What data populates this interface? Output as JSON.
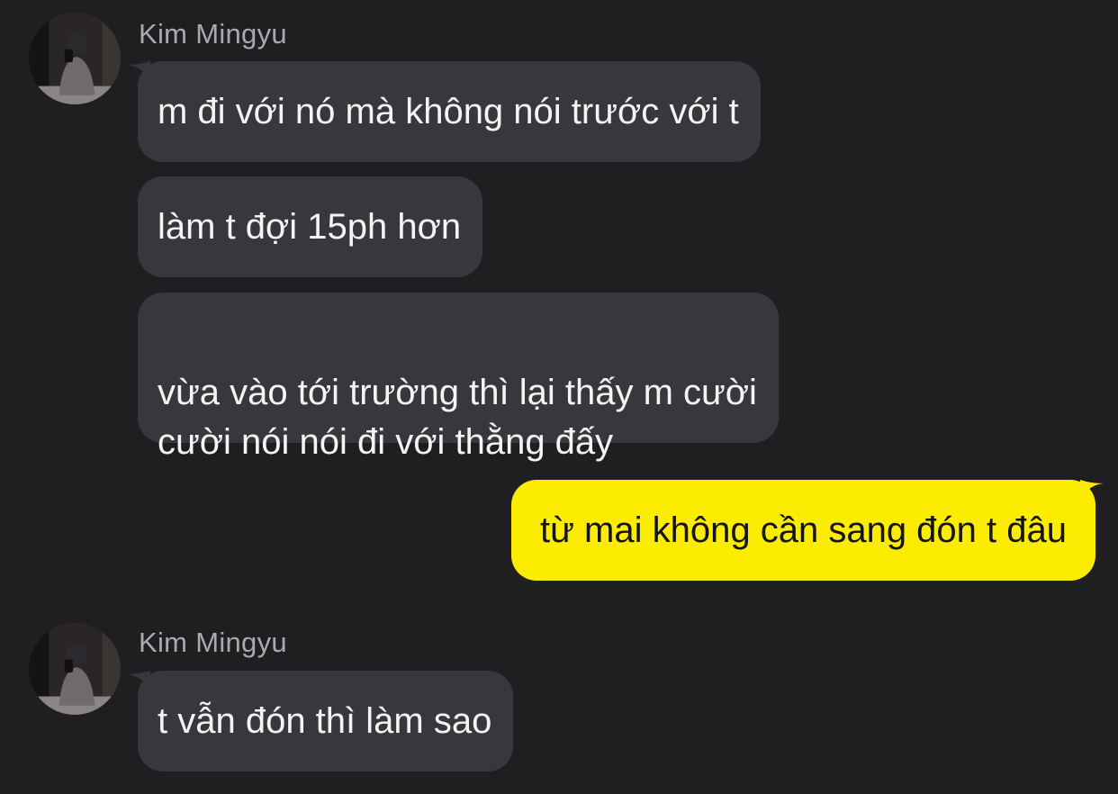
{
  "conversation": {
    "groups": [
      {
        "sender": "Kim Mingyu",
        "messages": [
          "m đi với nó mà không nói trước với t",
          "làm t đợi 15ph hơn",
          "vừa vào tới trường thì lại thấy m cười\ncười nói nói đi với thằng đấy"
        ]
      },
      {
        "sender": "me",
        "messages": [
          "từ mai không cần sang đón t đâu"
        ]
      },
      {
        "sender": "Kim Mingyu",
        "messages": [
          "t vẫn đón thì làm sao"
        ]
      }
    ]
  },
  "colors": {
    "background": "#1f1f22",
    "incoming_bubble": "#38383c",
    "outgoing_bubble": "#fcec02",
    "sender_name": "#a9a9ae"
  },
  "icons": {
    "avatar": "profile-photo-avatar"
  }
}
